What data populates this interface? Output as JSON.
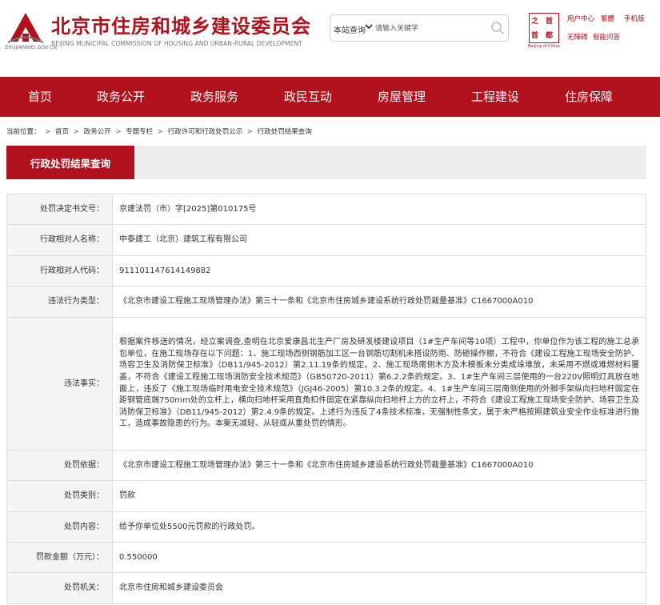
{
  "header": {
    "logo_domain": "ZHUJIANWEI.GOV.CN",
    "title": "北京市住房和城乡建设委员会",
    "subtitle": "BEIJING MUNICIPAL COMMISSION OF HOUSING AND URBAN-RURAL DEVELOPMENT",
    "search": {
      "scope": "本站查询",
      "placeholder": "请输入关键字"
    },
    "capital_logo": {
      "cells": [
        "之",
        "首",
        "首",
        "都"
      ],
      "en": "Beijing of China"
    },
    "top_links": [
      "用户中心",
      "繁體",
      "手机版",
      "无障碍",
      "智能问答"
    ]
  },
  "nav": {
    "items": [
      "首页",
      "政务公开",
      "政务服务",
      "政民互动",
      "房屋管理",
      "工程建设",
      "住房保障"
    ]
  },
  "breadcrumb": {
    "prefix": "当前位置：",
    "items": [
      "首页",
      "政务公开",
      "专题专栏",
      "行政许可和行政处罚公示",
      "行政处罚结果查询"
    ]
  },
  "section": {
    "title": "行政处罚结果查询"
  },
  "record": {
    "rows": [
      {
        "label": "处罚决定书文号：",
        "value": "京建法罚（市）字[2025]第010175号"
      },
      {
        "label": "行政相对人名称：",
        "value": "中泰建工（北京）建筑工程有限公司"
      },
      {
        "label": "行政相对人代码：",
        "value": "91110114761414​9882"
      },
      {
        "label": "违法行为类型：",
        "value": "《北京市建设工程施工现场管理办法》第三十一条和《北京市住房城乡建设系统行政处罚裁量基准》C1667000A010"
      },
      {
        "label": "违法事实：",
        "value": "根据案件移送的情况，经立案调查,查明在北京爱康昌北生产厂房及研发楼建设项目（1#生产车间等10项）工程中，你单位作为该工程的施工总承包单位，在施工现场存在以下问题：1、施工现场西侧钢筋加工区一台钢筋切割机未搭设防雨、防砸操作棚，不符合《建设工程施工现场安全防护、场容卫生及消防保卫标准》（DB11/945-2012）第2.11.19条的规定。2、施工现场南侧木方及木模板未分类成垛堆放，未采用不燃或难燃材料覆盖，不符合《建设工程施工现场消防安全技术规范》（GB50720-2011）第6.2.2条的规定。3、1#生产车间三层使用的一台220V照明灯具放在地面上，违反了《施工现场临时用电安全技术规范》（JGJ46-2005）第10.3.2条的规定。4、1#生产车间三层南侧使用的外脚手架纵向扫地杆固定在距钢管底端750mm处的立杆上，横向扫地杆采用直角扣件固定在紧靠纵向扫地杆上方的立杆上，不符合《建设工程施工现场安全防护、场容卫生及消防保卫标准》（DB11/945-2012）第2.4.9条的规定。上述行为违反了4条技术标准，无强制性条文，属于未严格按照建筑业安全作业标准进行施工，造成事故隐患的行为。本案无减轻、从轻或从重处罚的情形。"
      },
      {
        "label": "处罚依据：",
        "value": "《北京市建设工程施工现场管理办法》第三十一条和《北京市住房城乡建设系统行政处罚裁量基准》C1667000A010"
      },
      {
        "label": "处罚类别：",
        "value": "罚款"
      },
      {
        "label": "处罚内容：",
        "value": "给予你单位处5500元罚款的行政处罚。"
      },
      {
        "label": "罚款金额（万元）：",
        "value": "0.550000"
      },
      {
        "label": "处罚机关：",
        "value": "北京市住房和城乡建设委员会"
      }
    ]
  },
  "colors": {
    "brand_red": "#b0111c",
    "label_bg": "#f4f4f4",
    "section_bar_bg": "#ededed"
  }
}
